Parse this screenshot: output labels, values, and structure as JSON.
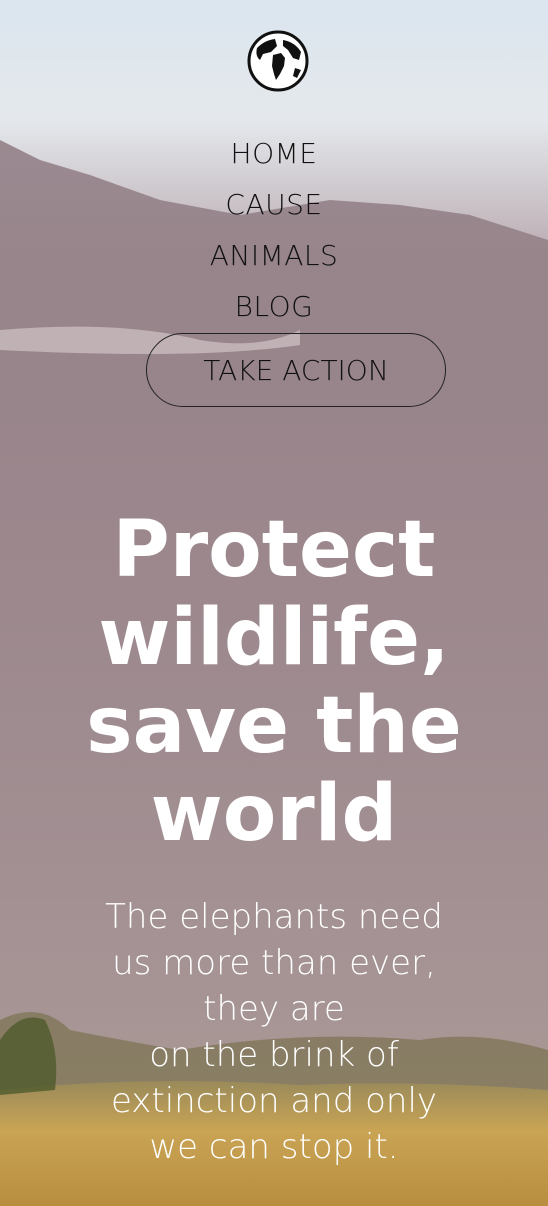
{
  "logo": {
    "icon": "globe-icon"
  },
  "nav": {
    "items": [
      {
        "label": "HOME"
      },
      {
        "label": "CAUSE"
      },
      {
        "label": "ANIMALS"
      },
      {
        "label": "BLOG"
      }
    ],
    "cta_label": "TAKE ACTION"
  },
  "hero": {
    "title": "Protect wildlife, save the world",
    "text_lines": [
      "The elephants need",
      "us more than ever,",
      "they are",
      "on the brink of",
      "extinction and only",
      "we can stop it."
    ]
  },
  "colors": {
    "text_dark": "#111111",
    "hero_text": "#ffffff",
    "sky": "#dbe6ee",
    "grass": "#c7a35b"
  }
}
